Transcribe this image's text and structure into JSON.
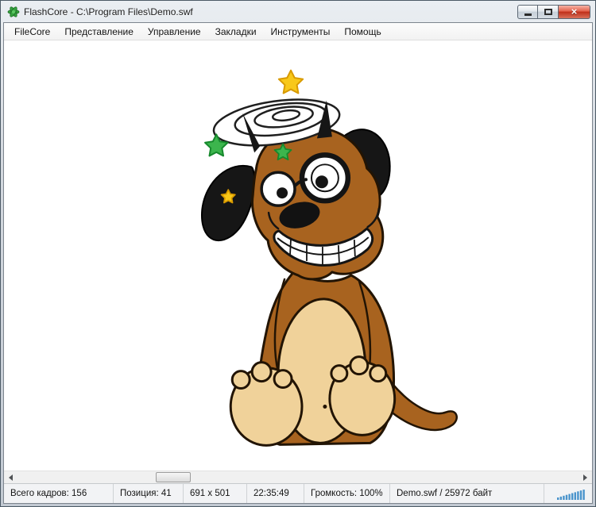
{
  "window": {
    "title": "FlashCore - C:\\Program Files\\Demo.swf",
    "controls": {
      "minimize": "minimize",
      "maximize": "maximize",
      "close_glyph": "×"
    }
  },
  "menu": {
    "items": [
      "FileCore",
      "Представление",
      "Управление",
      "Закладки",
      "Инструменты",
      "Помощь"
    ]
  },
  "content": {
    "description": "Flash animation frame: cartoon brown dog sitting, dizzy white swirl above its head with yellow and green stars, black floppy ears, large googly eyes, black oval nose, big toothy grin, cream belly with dot, big cream feet with toes, thin tail curling to the right on a white stage",
    "colors": {
      "dog_body": "#a8631f",
      "dog_belly": "#f0d29a",
      "outline": "#221404",
      "star_yellow": "#f8c819",
      "star_green": "#3cb54d",
      "stage_background": "#ffffff"
    }
  },
  "icons": {
    "app": "flashcore-flower-icon",
    "volume": "volume-bars-icon",
    "scroll_left": "triangle-left",
    "scroll_right": "triangle-right"
  },
  "statusbar": {
    "panes": [
      "Всего кадров: 156",
      "Позиция: 41",
      "691 x 501",
      "22:35:49",
      "Громкость: 100%",
      "Demo.swf / 25972 байт"
    ]
  }
}
